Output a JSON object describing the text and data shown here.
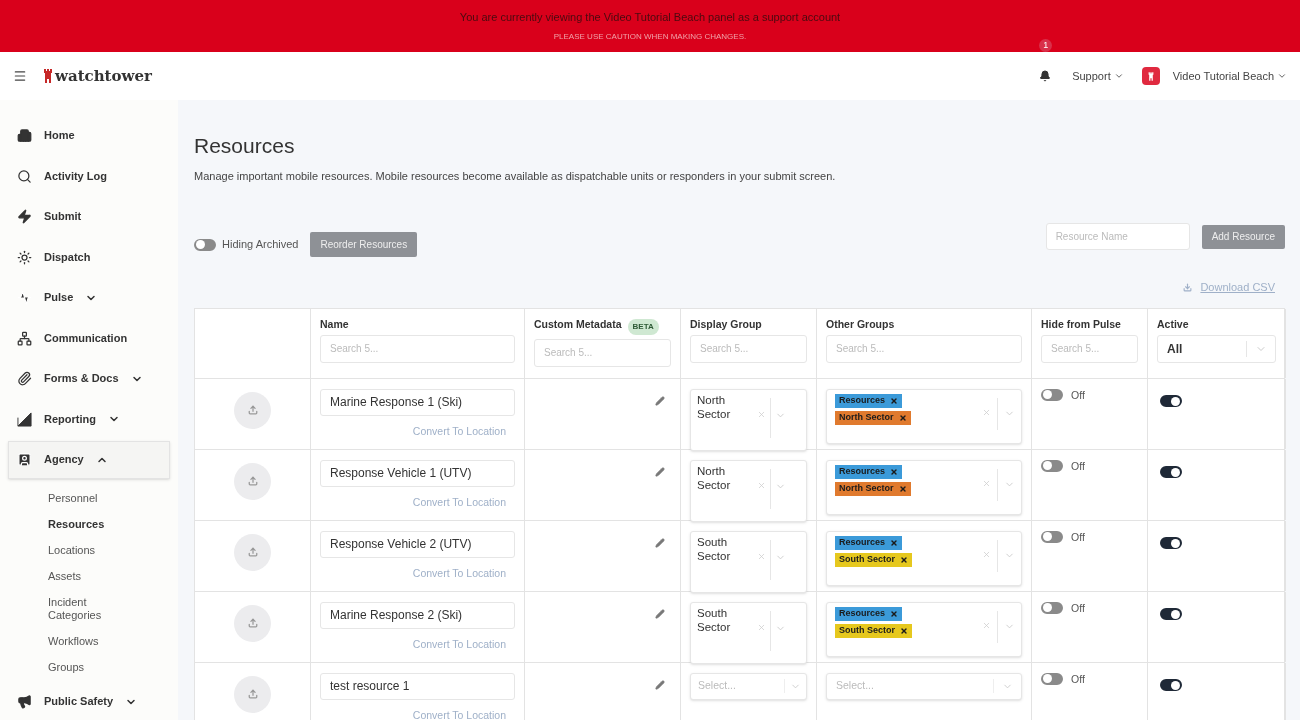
{
  "banner": {
    "message": "You are currently viewing the Video Tutorial Beach panel as a support account",
    "caution": "PLEASE USE CAUTION WHEN MAKING CHANGES."
  },
  "header": {
    "logo": "watchtower",
    "notification_count": "1",
    "support": "Support",
    "organization": "Video Tutorial Beach"
  },
  "sidebar": {
    "items": [
      {
        "label": "Home",
        "selected": false
      },
      {
        "label": "Activity Log",
        "selected": false
      },
      {
        "label": "Submit",
        "selected": false
      },
      {
        "label": "Dispatch",
        "selected": false
      },
      {
        "label": "Pulse",
        "selected": false,
        "expanded": false
      },
      {
        "label": "Communication",
        "selected": false
      },
      {
        "label": "Forms & Docs",
        "selected": false,
        "expanded": false
      },
      {
        "label": "Reporting",
        "selected": false,
        "expanded": false
      },
      {
        "label": "Agency",
        "selected": true,
        "expanded": true,
        "children": [
          {
            "label": "Personnel",
            "selected": false
          },
          {
            "label": "Resources",
            "selected": true
          },
          {
            "label": "Locations",
            "selected": false
          },
          {
            "label": "Assets",
            "selected": false
          },
          {
            "label": "Incident Categories",
            "selected": false
          },
          {
            "label": "Workflows",
            "selected": false
          },
          {
            "label": "Groups",
            "selected": false
          }
        ]
      },
      {
        "label": "Public Safety",
        "selected": false,
        "expanded": false
      }
    ]
  },
  "page": {
    "title": "Resources",
    "description": "Manage important mobile resources. Mobile resources become available as dispatchable units or responders in your submit screen.",
    "archived_toggle": {
      "label": "Hiding Archived",
      "on": false
    },
    "reorder_button": "Reorder Resources",
    "name_field": {
      "placeholder": "Resource Name"
    },
    "add_button": "Add Resource",
    "download_link": "Download CSV"
  },
  "table": {
    "columns": [
      {},
      {
        "label": "Name",
        "filter": {
          "kind": "search",
          "placeholder": "Search 5..."
        }
      },
      {
        "label": "Custom Metadata",
        "badge": "BETA",
        "filter": {
          "kind": "search",
          "placeholder": "Search 5..."
        }
      },
      {
        "label": "Display Group",
        "filter": {
          "kind": "search",
          "placeholder": "Search 5..."
        }
      },
      {
        "label": "Other Groups",
        "filter": {
          "kind": "search",
          "placeholder": "Search 5..."
        }
      },
      {
        "label": "Hide from Pulse",
        "filter": {
          "kind": "search",
          "placeholder": "Search 5..."
        }
      },
      {
        "label": "Active",
        "filter": {
          "kind": "select",
          "value": "All"
        }
      }
    ],
    "rows": [
      {
        "name": "Marine Response 1 (Ski)",
        "link": "Convert To Location",
        "display_group": {
          "value": "North Sector"
        },
        "other_groups": {
          "tags": [
            {
              "label": "Resources",
              "color": "#3b9ad9"
            },
            {
              "label": "North Sector",
              "color": "#e07a2e"
            }
          ]
        },
        "hide_from_pulse": {
          "on": false,
          "label": "Off"
        },
        "active": {
          "on": true
        }
      },
      {
        "name": "Response Vehicle 1 (UTV)",
        "link": "Convert To Location",
        "display_group": {
          "value": "North Sector"
        },
        "other_groups": {
          "tags": [
            {
              "label": "Resources",
              "color": "#3b9ad9"
            },
            {
              "label": "North Sector",
              "color": "#e07a2e"
            }
          ]
        },
        "hide_from_pulse": {
          "on": false,
          "label": "Off"
        },
        "active": {
          "on": true
        }
      },
      {
        "name": "Response Vehicle 2 (UTV)",
        "link": "Convert To Location",
        "display_group": {
          "value": "South Sector"
        },
        "other_groups": {
          "tags": [
            {
              "label": "Resources",
              "color": "#3b9ad9"
            },
            {
              "label": "South Sector",
              "color": "#e6c81e"
            }
          ]
        },
        "hide_from_pulse": {
          "on": false,
          "label": "Off"
        },
        "active": {
          "on": true
        }
      },
      {
        "name": "Marine Response 2 (Ski)",
        "link": "Convert To Location",
        "display_group": {
          "value": "South Sector"
        },
        "other_groups": {
          "tags": [
            {
              "label": "Resources",
              "color": "#3b9ad9"
            },
            {
              "label": "South Sector",
              "color": "#e6c81e"
            }
          ]
        },
        "hide_from_pulse": {
          "on": false,
          "label": "Off"
        },
        "active": {
          "on": true
        }
      },
      {
        "name": "test resource 1",
        "link": "Convert To Location",
        "display_group": {
          "placeholder": "Select..."
        },
        "other_groups": {
          "placeholder": "Select..."
        },
        "hide_from_pulse": {
          "on": false,
          "label": "Off"
        },
        "active": {
          "on": true
        }
      }
    ]
  }
}
